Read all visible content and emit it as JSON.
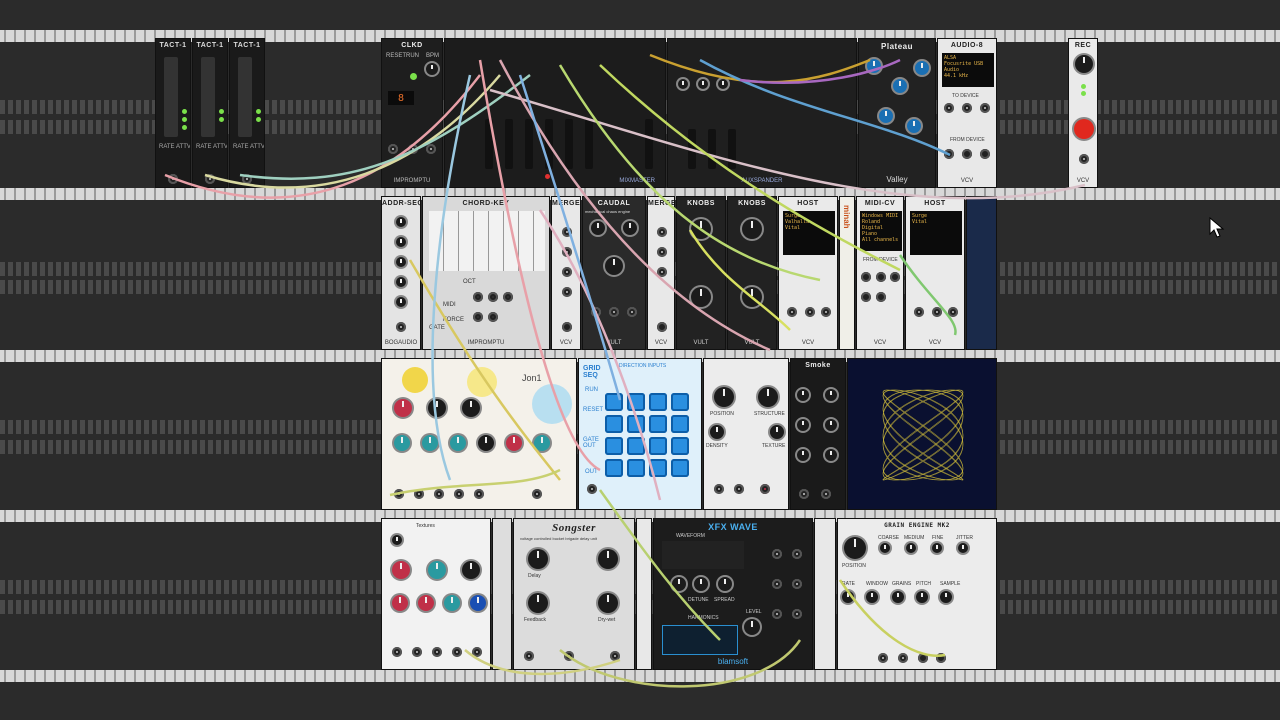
{
  "rack": {
    "background": "#2b2b2b",
    "rail_light": "#d8d8d8",
    "rail_dark": "#3a3a3a"
  },
  "row1": {
    "tact": [
      {
        "title": "TACT-1",
        "labels": [
          "RATE",
          "ATTV"
        ]
      },
      {
        "title": "TACT-1",
        "labels": [
          "RATE",
          "ATTV"
        ]
      },
      {
        "title": "TACT-1",
        "labels": [
          "RATE",
          "ATTV"
        ]
      }
    ],
    "clkd": {
      "title": "CLKD",
      "labels": [
        "RESET",
        "RUN",
        "BPM"
      ],
      "display": "8",
      "foot": "IMPROMPTU"
    },
    "mixmaster": {
      "title": "MIXMASTER"
    },
    "auxspander": {
      "title": "AUXSPANDER"
    },
    "plateau": {
      "title": "Plateau",
      "foot": "Valley"
    },
    "audio": {
      "title": "AUDIO-8",
      "screen": [
        "ALSA",
        "Focusrite USB Audio",
        "44.1 kHz"
      ],
      "label_to": "TO DEVICE",
      "label_from": "FROM DEVICE",
      "foot": "VCV"
    },
    "rec": {
      "title": "REC",
      "foot": "VCV"
    }
  },
  "row2": {
    "addrseq": {
      "title": "ADDR-SEQ",
      "foot": "BOGAUDIO"
    },
    "chordkey": {
      "title": "CHORD-KEY",
      "labels": [
        "OCT",
        "MIDI",
        "FORCE",
        "GATE"
      ],
      "foot": "IMPROMPTU"
    },
    "merge1": {
      "title": "MERGE",
      "foot": "VCV"
    },
    "caudal": {
      "title": "CAUDAL",
      "subtitle": "mechanical chaos engine",
      "foot": "VULT"
    },
    "merge2": {
      "title": "MERGE",
      "foot": "VCV"
    },
    "knobs1": {
      "title": "KNOBS",
      "foot": "VULT"
    },
    "knobs2": {
      "title": "KNOBS",
      "foot": "VULT"
    },
    "host1": {
      "title": "HOST",
      "screen": [
        "Surge",
        "Valhalla",
        "Vital"
      ],
      "foot": "VCV"
    },
    "minah": {
      "title": "minah"
    },
    "midicv": {
      "title": "MIDI-CV",
      "screen": [
        "Windows MIDI",
        "Roland Digital Piano",
        "All channels"
      ],
      "label": "FROM DEVICE",
      "foot": "VCV"
    },
    "host2": {
      "title": "HOST",
      "screen": [
        "Surge",
        "Vital"
      ],
      "foot": "VCV"
    }
  },
  "row3": {
    "jon1": {
      "title": "Jon1"
    },
    "gridseq": {
      "title": "GRID SEQ",
      "labels": [
        "RUN",
        "RESET",
        "GATE OUT",
        "OUT"
      ],
      "header": "DIRECTION INPUTS"
    },
    "texture": {
      "labels": [
        "POSITION",
        "STRUCTURE",
        "DENSITY",
        "TEXTURE"
      ]
    },
    "smoke": {
      "title": "Smoke"
    },
    "scope": {
      "trace_color": "#d6c23a"
    }
  },
  "row4": {
    "textures": {
      "title": "Textures"
    },
    "songster": {
      "title": "Songster",
      "subtitle": "voltage controlled bucket brigade delay unit",
      "labels": [
        "Delay",
        "Feedback",
        "Dry-wet"
      ]
    },
    "xfx": {
      "title": "XFX WAVE",
      "labels": [
        "WAVEFORM",
        "PHASE",
        "DETUNE",
        "SPREAD",
        "DENSITY",
        "HARMONICS",
        "LEVEL",
        "FREQ"
      ],
      "foot": "blamsoft"
    },
    "grain": {
      "title": "GRAIN ENGINE MK2",
      "labels": [
        "POSITION",
        "COARSE",
        "MEDIUM",
        "FINE",
        "JITTER",
        "RATE",
        "WINDOW",
        "GRAINS",
        "PITCH",
        "SAMPLE"
      ]
    }
  }
}
